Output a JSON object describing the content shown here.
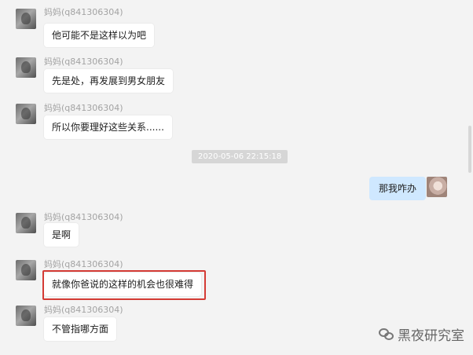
{
  "messages": [
    {
      "sender": "妈妈(q841306304)",
      "text": "他可能不是这样以为吧"
    },
    {
      "sender": "妈妈(q841306304)",
      "text": "先是处，再发展到男女朋友"
    },
    {
      "sender": "妈妈(q841306304)",
      "text": "所以你要理好这些关系......"
    },
    {
      "sender": "妈妈(q841306304)",
      "text": "是啊"
    },
    {
      "sender": "妈妈(q841306304)",
      "text": "就像你爸说的这样的机会也很难得"
    },
    {
      "sender": "妈妈(q841306304)",
      "text": "不管指哪方面"
    }
  ],
  "timestamp": "2020-05-06 22:15:18",
  "outgoing": {
    "text": "那我咋办"
  },
  "watermark": {
    "text": "黑夜研究室"
  }
}
